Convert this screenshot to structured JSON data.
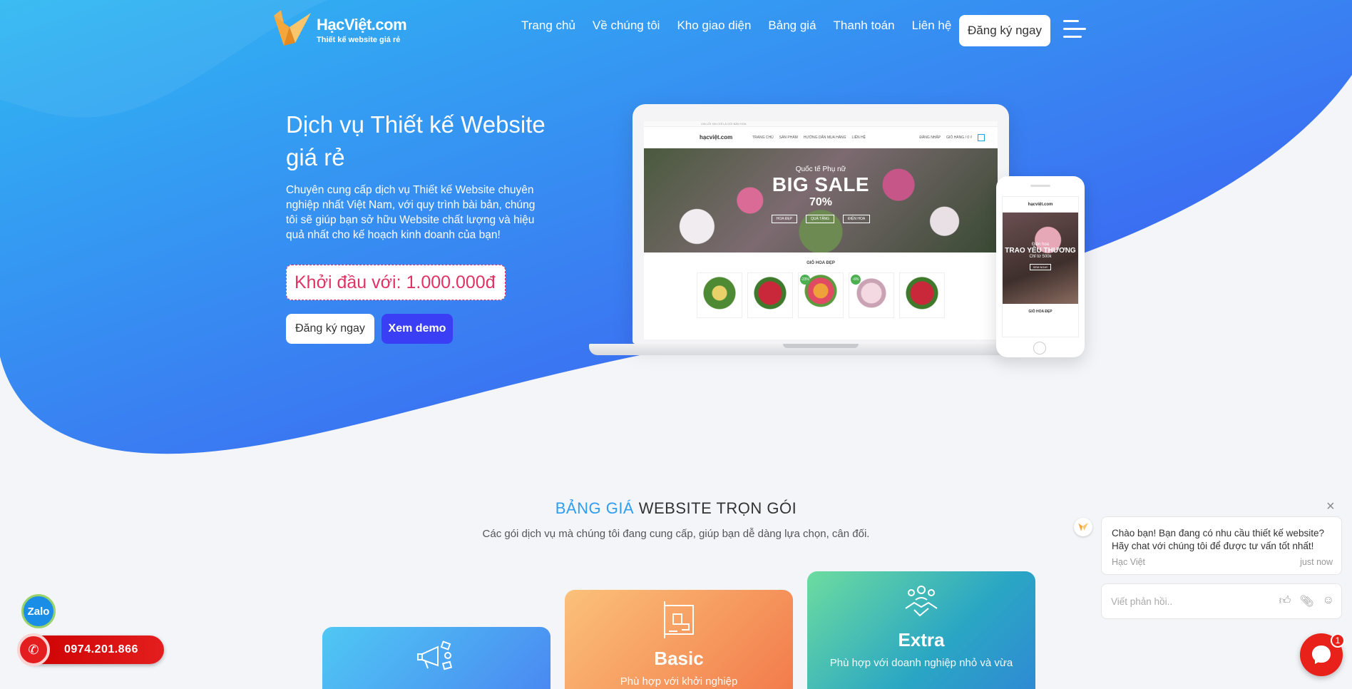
{
  "brand": {
    "name": "HạcViệt.com",
    "tagline": "Thiết kế website giá rẻ"
  },
  "nav": {
    "items": [
      "Trang chủ",
      "Về chúng tôi",
      "Kho giao diện",
      "Bảng giá",
      "Thanh toán",
      "Liên hệ"
    ],
    "cta": "Đăng ký ngay"
  },
  "hero": {
    "title": "Dịch vụ Thiết kế Website giá rẻ",
    "description": "Chuyên cung cấp dịch vụ Thiết kế Website chuyên nghiệp nhất Việt Nam, với quy trình bài bản, chúng tôi sẽ giúp bạn sở hữu Website chất lượng và hiệu quả nhất cho kế hoạch kinh doanh của bạn!",
    "price": "Khởi đầu với: 1.000.000đ",
    "btn_register": "Đăng ký ngay",
    "btn_demo": "Xem demo"
  },
  "mockup": {
    "topbar": "XIN LỖI XIN CHỈ LÀ GÓI BÁN HOA",
    "logo": "hạcviệt.com",
    "menu": [
      "TRANG CHỦ",
      "SẢN PHẨM",
      "HƯỚNG DẪN MUA HÀNG",
      "LIÊN HỆ"
    ],
    "right": [
      "ĐĂNG NHẬP",
      "GIỎ HÀNG / 0 ₫"
    ],
    "banner_small": "Quốc tế Phụ nữ",
    "banner_big": "BIG SALE",
    "banner_pct": "70%",
    "banner_btns": [
      "HOA ĐẸP",
      "QUÀ TẶNG",
      "ĐIỆN HOA"
    ],
    "section": "GIỎ HOA ĐẸP",
    "badges": [
      "-23%",
      "-6%"
    ],
    "phone_banner": [
      "Điện hoa",
      "TRAO YÊU THƯƠNG",
      "Chỉ từ 500k",
      "XEM NGAY"
    ]
  },
  "pricing": {
    "title_highlight": "BẢNG GIÁ",
    "title_rest": "WEBSITE TRỌN GÓI",
    "subtitle": "Các gói dịch vụ mà chúng tôi đang cung cấp, giúp bạn dễ dàng lựa chọn, cân đối.",
    "cards": [
      {
        "name": "",
        "desc": ""
      },
      {
        "name": "Basic",
        "desc": "Phù hợp với khởi nghiệp"
      },
      {
        "name": "Extra",
        "desc": "Phù hợp với doanh nghiệp nhỏ và vừa"
      }
    ]
  },
  "contact": {
    "zalo": "Zalo",
    "hotline": "0974.201.866"
  },
  "chat": {
    "message": "Chào bạn! Bạn đang có nhu cầu thiết kế website? Hãy chat với chúng tôi để được tư vấn tốt nhất!",
    "sender": "Hạc Việt",
    "time": "just now",
    "input_placeholder": "Viết phản hồi..",
    "badge": "1"
  },
  "colors": {
    "hero_gradient_start": "#2fb8f2",
    "hero_gradient_end": "#3d4cf0",
    "accent_red": "#e03365",
    "demo_button": "#3a3ff5"
  }
}
